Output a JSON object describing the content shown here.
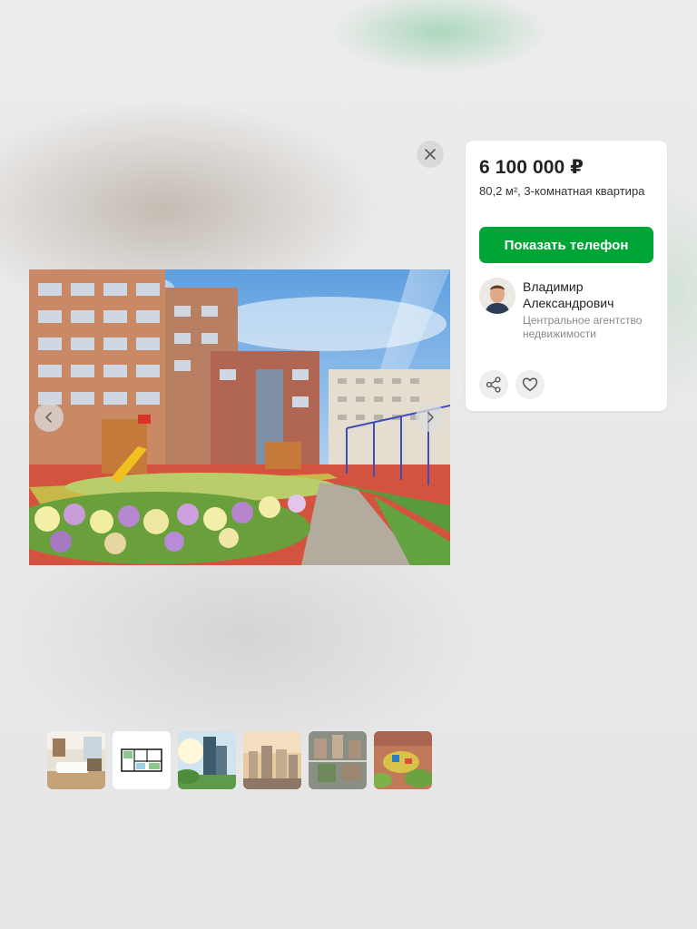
{
  "window": {
    "close_icon": "close-icon"
  },
  "gallery": {
    "main_photo_alt": "courtyard-render",
    "prev_icon": "chevron-left-icon",
    "next_icon": "chevron-right-icon",
    "thumbnails": [
      {
        "name": "interior-living-room"
      },
      {
        "name": "floor-plan"
      },
      {
        "name": "tower-exterior"
      },
      {
        "name": "city-skyline"
      },
      {
        "name": "aerial-district"
      },
      {
        "name": "aerial-playground"
      }
    ]
  },
  "listing": {
    "price": "6 100 000 ₽",
    "description": "80,2 м², 3-комнатная квартира",
    "phone_button": "Показать телефон",
    "accent_color": "#00a536"
  },
  "agent": {
    "name": "Владимир Александрович",
    "company": "Центральное агентство недвижимости"
  },
  "actions": {
    "share_icon": "share-icon",
    "favorite_icon": "heart-icon"
  }
}
